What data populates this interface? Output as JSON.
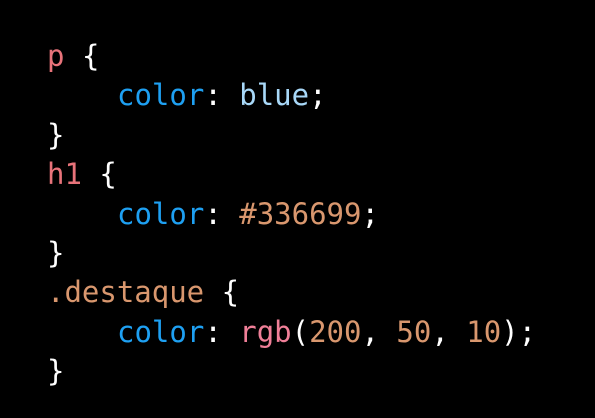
{
  "colors": {
    "background": "#000000",
    "selector": "#e8737a",
    "brace": "#ffffff",
    "property": "#1ea0f2",
    "keyword": "#a8d8f8",
    "number": "#d9976e",
    "function": "#f07f98",
    "class_selector": "#d9976e",
    "punctuation": "#ffffff"
  },
  "lines": [
    {
      "tokens": [
        {
          "text": "p",
          "role": "selector"
        },
        {
          "text": " ",
          "role": "punctuation"
        },
        {
          "text": "{",
          "role": "brace"
        }
      ]
    },
    {
      "indent": true,
      "tokens": [
        {
          "text": "color",
          "role": "property"
        },
        {
          "text": ": ",
          "role": "punctuation"
        },
        {
          "text": "blue",
          "role": "keyword"
        },
        {
          "text": ";",
          "role": "punctuation"
        }
      ]
    },
    {
      "tokens": [
        {
          "text": "}",
          "role": "brace"
        }
      ]
    },
    {
      "tokens": [
        {
          "text": "h1",
          "role": "selector"
        },
        {
          "text": " ",
          "role": "punctuation"
        },
        {
          "text": "{",
          "role": "brace"
        }
      ]
    },
    {
      "indent": true,
      "tokens": [
        {
          "text": "color",
          "role": "property"
        },
        {
          "text": ": ",
          "role": "punctuation"
        },
        {
          "text": "#336699",
          "role": "number"
        },
        {
          "text": ";",
          "role": "punctuation"
        }
      ]
    },
    {
      "tokens": [
        {
          "text": "}",
          "role": "brace"
        }
      ]
    },
    {
      "tokens": [
        {
          "text": ".destaque",
          "role": "class_selector"
        },
        {
          "text": " ",
          "role": "punctuation"
        },
        {
          "text": "{",
          "role": "brace"
        }
      ]
    },
    {
      "indent": true,
      "tokens": [
        {
          "text": "color",
          "role": "property"
        },
        {
          "text": ": ",
          "role": "punctuation"
        },
        {
          "text": "rgb",
          "role": "function"
        },
        {
          "text": "(",
          "role": "punctuation"
        },
        {
          "text": "200",
          "role": "number"
        },
        {
          "text": ", ",
          "role": "punctuation"
        },
        {
          "text": "50",
          "role": "number"
        },
        {
          "text": ", ",
          "role": "punctuation"
        },
        {
          "text": "10",
          "role": "number"
        },
        {
          "text": ");",
          "role": "punctuation"
        }
      ]
    },
    {
      "tokens": [
        {
          "text": "}",
          "role": "brace"
        }
      ]
    }
  ]
}
